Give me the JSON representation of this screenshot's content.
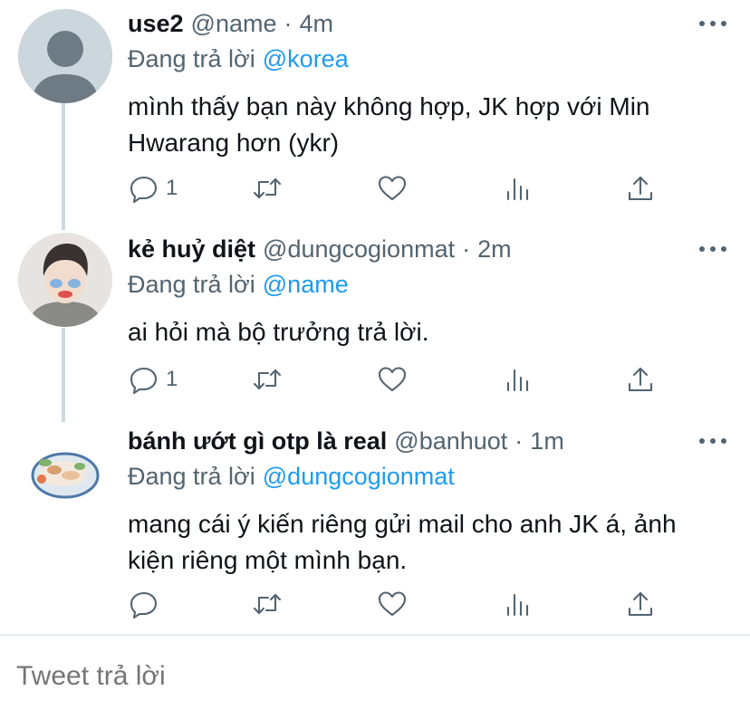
{
  "tweets": [
    {
      "name": "use2",
      "handle": "@name",
      "time": "4m",
      "replying_label": "Đang trả lời",
      "replying_to": "@korea",
      "text": "mình thấy bạn này không hợp, JK hợp với Min Hwarang hơn (ykr)",
      "reply_count": "1",
      "avatar_icon": "default-profile-icon"
    },
    {
      "name": "kẻ huỷ diệt",
      "handle": "@dungcogionmat",
      "time": "2m",
      "replying_label": "Đang trả lời",
      "replying_to": "@name",
      "text": "ai hỏi mà bộ trưởng trả lời.",
      "reply_count": "1",
      "avatar_icon": "person-photo-avatar"
    },
    {
      "name": "bánh ướt gì otp là real",
      "handle": "@banhuot",
      "time": "1m",
      "replying_label": "Đang trả lời",
      "replying_to": "@dungcogionmat",
      "text": "mang cái ý kiến riêng gửi mail cho anh JK á, ảnh kiện riêng một mình bạn.",
      "reply_count": "",
      "avatar_icon": "food-plate-avatar"
    }
  ],
  "reply_input": {
    "placeholder": "Tweet trả lời"
  },
  "colors": {
    "text": "#0f1419",
    "secondary": "#536471",
    "link": "#1d9bf0",
    "thread_line": "#cfd9de"
  }
}
